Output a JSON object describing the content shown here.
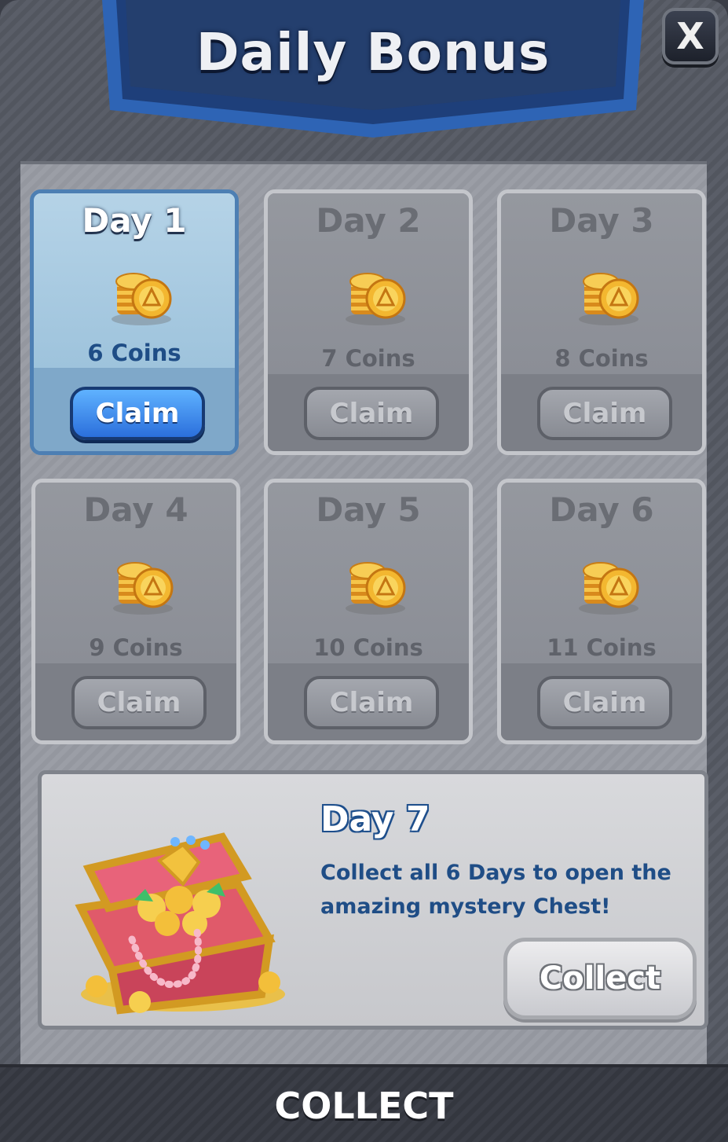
{
  "header": {
    "title": "Daily Bonus",
    "close_label": "X"
  },
  "days": [
    {
      "label": "Day 1",
      "reward": "6 Coins",
      "button": "Claim",
      "active": true
    },
    {
      "label": "Day 2",
      "reward": "7 Coins",
      "button": "Claim",
      "active": false
    },
    {
      "label": "Day 3",
      "reward": "8 Coins",
      "button": "Claim",
      "active": false
    },
    {
      "label": "Day 4",
      "reward": "9 Coins",
      "button": "Claim",
      "active": false
    },
    {
      "label": "Day 5",
      "reward": "10 Coins",
      "button": "Claim",
      "active": false
    },
    {
      "label": "Day 6",
      "reward": "11 Coins",
      "button": "Claim",
      "active": false
    }
  ],
  "day7": {
    "label": "Day 7",
    "description": "Collect all 6 Days to open the amazing mystery Chest!",
    "button": "Collect"
  },
  "footer": {
    "label": "COLLECT"
  },
  "icons": {
    "coins": "coin-stack-icon",
    "chest": "treasure-chest-icon",
    "close": "close-icon"
  },
  "colors": {
    "accent": "#2b6fdc",
    "banner": "#1e3f7a",
    "text_blue": "#1f4d86"
  }
}
